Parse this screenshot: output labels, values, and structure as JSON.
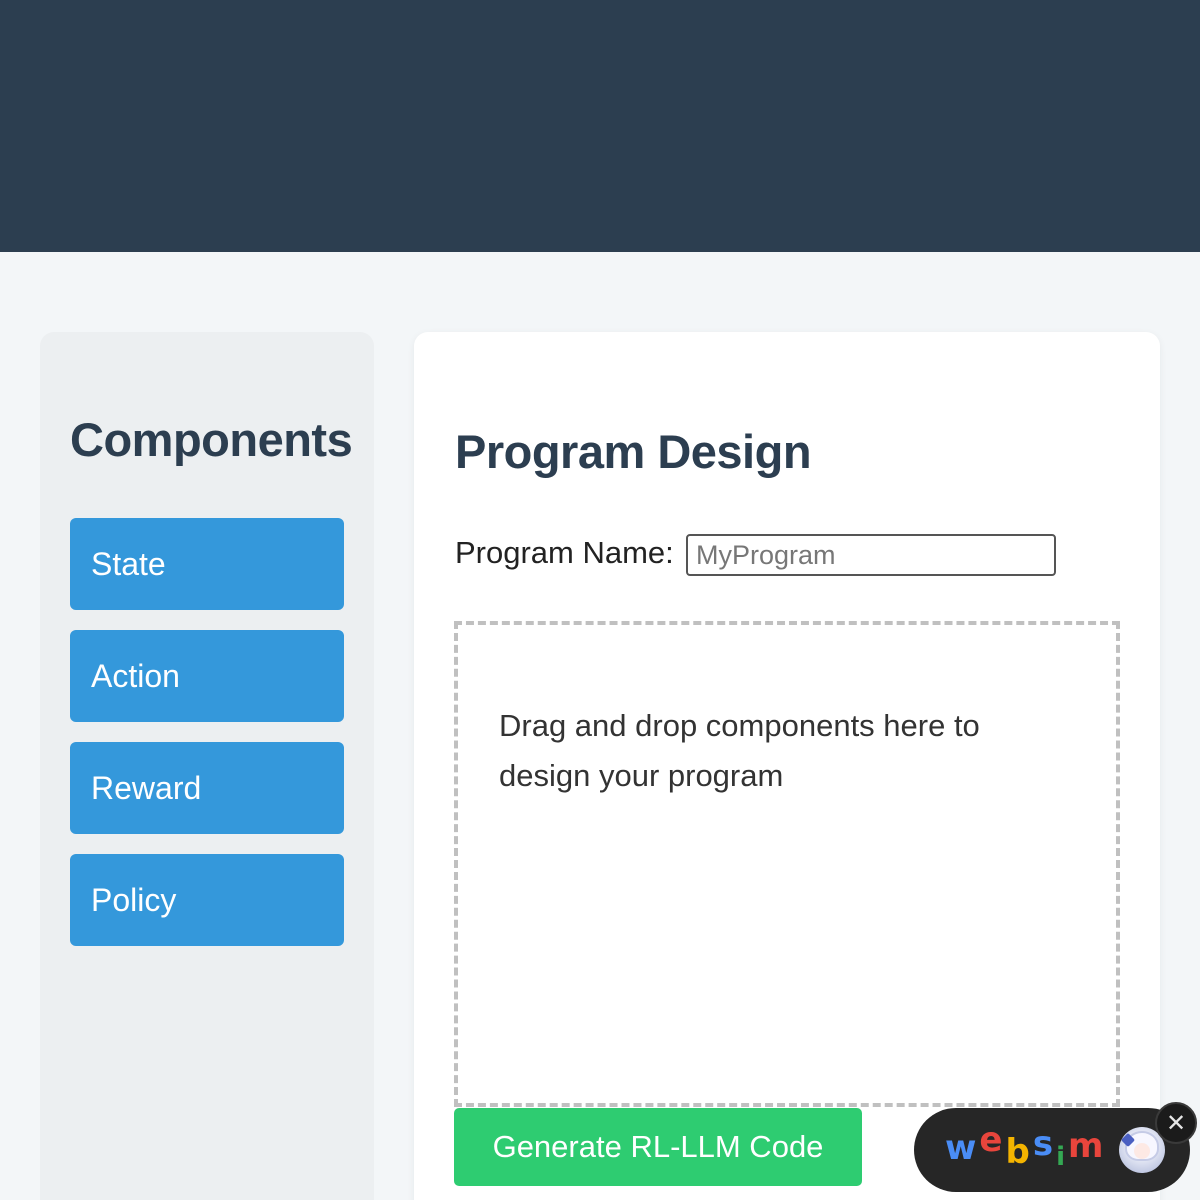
{
  "sidebar": {
    "title": "Components",
    "items": [
      {
        "label": "State"
      },
      {
        "label": "Action"
      },
      {
        "label": "Reward"
      },
      {
        "label": "Policy"
      }
    ]
  },
  "main": {
    "title": "Program Design",
    "program_name_label": "Program Name:",
    "program_name_placeholder": "MyProgram",
    "dropzone_text": "Drag and drop components here to design your program",
    "generate_button": "Generate RL-LLM Code"
  },
  "badge": {
    "letters": [
      "w",
      "e",
      "b",
      "s",
      "i",
      "m"
    ],
    "close_symbol": "✕"
  },
  "colors": {
    "header": "#2c3e50",
    "component_button": "#3498db",
    "generate_button": "#2ecc71",
    "text_dark": "#2c3e50"
  }
}
